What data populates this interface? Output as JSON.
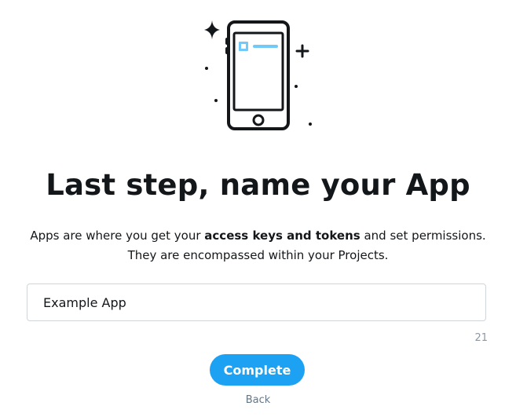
{
  "illustration": {
    "icon": "phone-illustration-icon",
    "sparkle_icon": "sparkle-icon",
    "accent_color": "#71c9f8"
  },
  "header": {
    "title": "Last step, name your App"
  },
  "description": {
    "part1": "Apps are where you get your ",
    "bold": "access keys and tokens",
    "part2": " and set permissions.",
    "line2": "They are encompassed within your Projects."
  },
  "form": {
    "app_name_value": "Example App",
    "char_count": "21"
  },
  "actions": {
    "complete_label": "Complete",
    "back_label": "Back",
    "primary_color": "#1da1f2"
  }
}
